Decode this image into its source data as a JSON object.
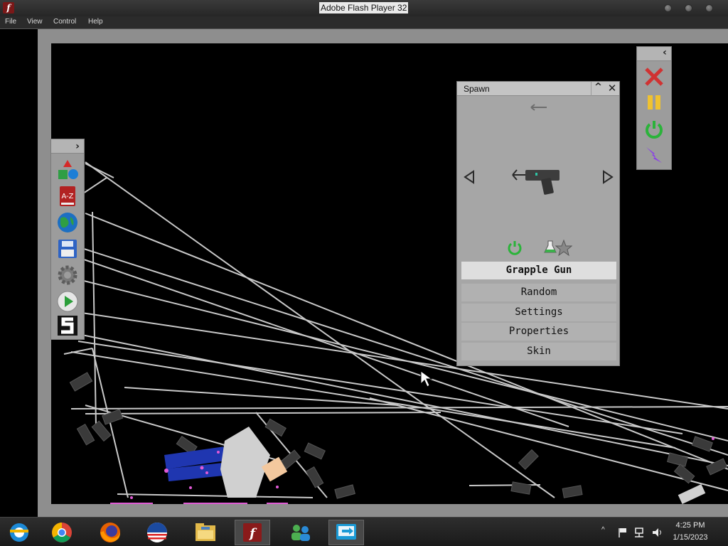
{
  "window": {
    "title": "Adobe Flash Player 32"
  },
  "menu": {
    "items": [
      "File",
      "View",
      "Control",
      "Help"
    ]
  },
  "left_toolbar": {
    "toggle_glyph": "›",
    "tools": [
      "shapes-icon",
      "a-z-book-icon",
      "globe-icon",
      "save-disk-icon",
      "gear-icon",
      "play-icon",
      "s-logo-icon"
    ],
    "az_label": "A-Z"
  },
  "right_toolbar": {
    "toggle_glyph": "‹",
    "tools": [
      "close-x-icon",
      "pause-icon",
      "power-icon",
      "lightning-icon"
    ]
  },
  "spawn_panel": {
    "title": "Spawn",
    "min_glyph": "^",
    "close_glyph": "✕",
    "selected_item": "Grapple Gun",
    "menu": [
      "Random",
      "Settings",
      "Properties",
      "Skin"
    ]
  },
  "taskbar": {
    "apps": [
      "ie-icon",
      "chrome-icon",
      "firefox-icon",
      "obama-logo-icon",
      "file-explorer-icon",
      "flash-player-icon",
      "people-icon",
      "remote-desktop-icon"
    ],
    "time": "4:25 PM",
    "date": "1/15/2023",
    "tray_glyph": "^"
  },
  "colors": {
    "stage_bg": "#000000",
    "panel_bg": "#a6a6a6",
    "rope": "#c9c9c9",
    "ragdoll_blue": "#1f36b0",
    "blood_pink": "#e15ad6"
  }
}
